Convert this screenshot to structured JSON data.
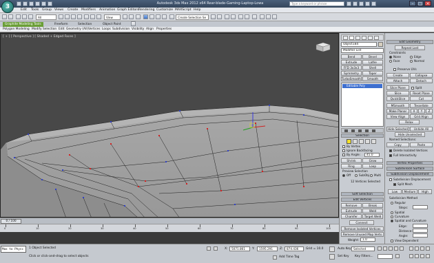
{
  "window": {
    "title": "Autodesk 3ds Max 2012 x64    Rear-blade-Gaming-Laptop-Lowa",
    "search_placeholder": "Type a keyword or phrase",
    "app_logo": "3"
  },
  "menu": [
    "Edit",
    "Tools",
    "Group",
    "Views",
    "Create",
    "Modifiers",
    "Animation",
    "Graph Editors",
    "Rendering",
    "Customize",
    "MAXScript",
    "Help"
  ],
  "toolbar": {
    "selection_filter": "All",
    "reference_coord": "View",
    "named_selection": "Create Selection Se"
  },
  "ribbon": {
    "tabs": [
      "Graphite Modeling Tools",
      "Freeform",
      "Selection",
      "Object Paint"
    ],
    "sub": [
      "Polygon Modeling",
      "Modify Selection",
      "Edit",
      "Geometry (All)",
      "Vertices",
      "Loops",
      "Subdivision",
      "Visibility",
      "Align",
      "Properties"
    ]
  },
  "viewport": {
    "label": "[ + ] [ Perspective ] [ Shaded + Edged Faces ]"
  },
  "command_panel": {
    "object_name": "Object184",
    "modifier_list": "Modifier List",
    "modifier_buttons": [
      "Bend",
      "Bevel",
      "Extrude",
      "Lathe",
      "FFD 3x3x3",
      "Shell",
      "Symmetry",
      "Taper",
      "TurboSmooth",
      "Smooth"
    ],
    "stack_item": "Editable Poly",
    "selection_rollout": "Selection",
    "by_vertex": "By Vertex",
    "ignore_backfacing": "Ignore Backfacing",
    "by_angle": "By Angle:",
    "angle_value": "45.0",
    "shrink": "Shrink",
    "grow": "Grow",
    "ring": "Ring",
    "loop": "Loop",
    "preview_selection": "Preview Selection",
    "preview_off": "Off",
    "preview_subobj": "SubObj",
    "preview_multi": "Multi",
    "selected_status": "12 Vertices Selected",
    "soft_selection": "Soft Selection",
    "edit_vertices": "Edit Vertices",
    "remove": "Remove",
    "break": "Break",
    "extrude": "Extrude",
    "weld": "Weld",
    "chamfer": "Chamfer",
    "target_weld": "Target Weld",
    "connect": "Connect",
    "remove_isolated": "Remove Isolated Vertices",
    "remove_unused": "Remove Unused Map Verts",
    "weight_label": "Weight:",
    "weight_value": "1.0"
  },
  "far_panel": {
    "edit_geometry": "Edit Geometry",
    "repeat_last": "Repeat Last",
    "constraints": "Constraints",
    "c_none": "None",
    "c_edge": "Edge",
    "c_face": "Face",
    "c_normal": "Normal",
    "preserve_uvs": "Preserve UVs",
    "create": "Create",
    "collapse": "Collapse",
    "attach": "Attach",
    "detach": "Detach",
    "slice_plane": "Slice Plane",
    "split": "Split",
    "slice": "Slice",
    "reset_plane": "Reset Plane",
    "quickslice": "QuickSlice",
    "cut": "Cut",
    "msmooth": "MSmooth",
    "tessellate": "Tessellate",
    "make_planar": "Make Planar",
    "x": "X",
    "y": "Y",
    "z": "Z",
    "view_align": "View Align",
    "grid_align": "Grid Align",
    "relax": "Relax",
    "hide_selected": "Hide Selected",
    "unhide_all": "Unhide All",
    "hide_unselected": "Hide Unselected",
    "named_selections": "Named Selections:",
    "copy": "Copy",
    "paste": "Paste",
    "delete_isolated": "Delete Isolated Vertices",
    "full_interactivity": "Full Interactivity",
    "vertex_properties": "Vertex Properties",
    "subdivision_surface": "Subdivision Surface",
    "subdivision_displacement": "Subdivision Displacement",
    "subdivision_displacement_chk": "Subdivision Displacement",
    "split_mesh": "Split Mesh",
    "low": "Low",
    "medium": "Medium",
    "high": "High",
    "subdivision_method": "Subdivision Method",
    "regular": "Regular",
    "steps": "Steps:",
    "spatial": "Spatial",
    "curvature": "Curvature",
    "spatial_curvature": "Spatial and Curvature",
    "edge": "Edge:",
    "distance": "Distance:",
    "angle": "Angle:",
    "view_dependent": "View Dependent"
  },
  "timeline": {
    "frame": "0 / 100",
    "ticks": [
      "0",
      "10",
      "20",
      "30",
      "40",
      "50",
      "60",
      "70",
      "80",
      "90",
      "100"
    ]
  },
  "status": {
    "maxscript": "Max to Physc",
    "selected": "1 Object Selected",
    "prompt": "Click or click-and-drag to select objects",
    "x_label": "X:",
    "x": "5071.861",
    "y_label": "Y:",
    "y": "1595.291",
    "z_label": "Z:",
    "z": "874.436",
    "grid": "Grid = 10.0",
    "auto_key": "Auto Key",
    "set_key": "Set Key",
    "selected_dd": "Selected",
    "key_filters": "Key Filters...",
    "add_time_tag": "Add Time Tag"
  },
  "colors": {
    "viewport_bg": "#484848",
    "mesh_face": "#9e9e9e",
    "vertex_red": "#d42020",
    "vertex_blue": "#3040c8",
    "stack_highlight": "#3d6fcf",
    "ribbon_green": "#6a9e36"
  }
}
